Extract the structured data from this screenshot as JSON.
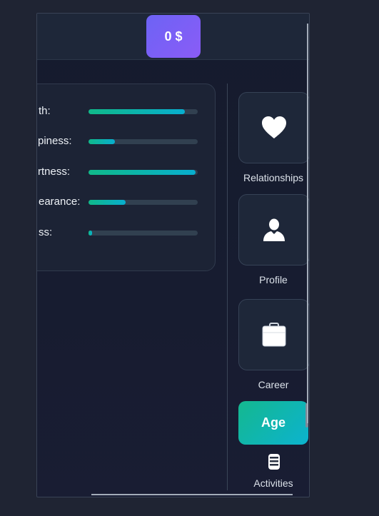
{
  "header": {
    "money_label": "0 $"
  },
  "stats": [
    {
      "label": "th:",
      "value": 0.88
    },
    {
      "label": "piness:",
      "value": 0.24
    },
    {
      "label": "rtness:",
      "value": 0.98
    },
    {
      "label": "earance:",
      "value": 0.34
    },
    {
      "label": "ss:",
      "value": 0.03
    }
  ],
  "sidebar": {
    "relationships": {
      "label": "Relationships",
      "icon": "heart-icon"
    },
    "profile": {
      "label": "Profile",
      "icon": "person-icon"
    },
    "career": {
      "label": "Career",
      "icon": "briefcase-icon"
    },
    "age_button": "Age",
    "activities": {
      "label": "Activities",
      "icon": "list-icon"
    }
  },
  "colors": {
    "money_button": "#7160f5",
    "progress_start": "#10b989",
    "progress_end": "#08aecf",
    "age_button_start": "#14b88f",
    "age_button_end": "#0cb3cf",
    "background": "#1f2433"
  }
}
